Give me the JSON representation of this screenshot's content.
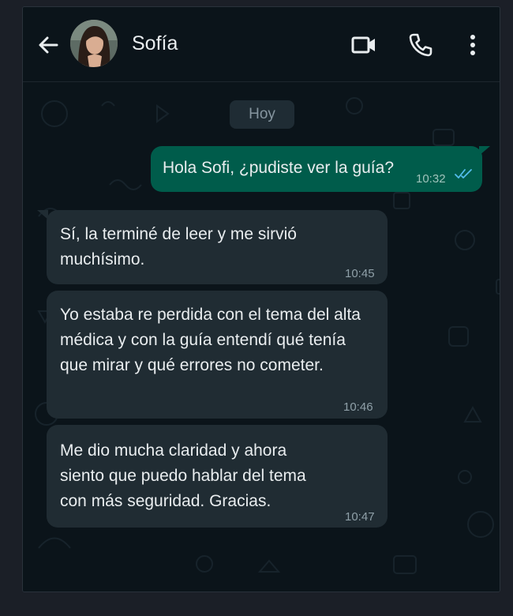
{
  "header": {
    "contact_name": "Sofía",
    "icons": [
      "arrow-back-icon",
      "avatar",
      "video-call-icon",
      "phone-call-icon",
      "more-vert-icon"
    ]
  },
  "chat": {
    "date_label": "Hoy",
    "messages": [
      {
        "direction": "outgoing",
        "text": "Hola Sofi, ¿pudiste ver la guía?",
        "time": "10:32",
        "status": "read"
      },
      {
        "direction": "incoming",
        "text": "Sí, la terminé de leer y me sirvió muchísimo.",
        "time": "10:45"
      },
      {
        "direction": "incoming",
        "text": "Yo estaba re perdida con el tema del alta médica y con la guía entendí qué tenía que mirar y qué errores no cometer.",
        "time": "10:46"
      },
      {
        "direction": "incoming",
        "text": "Me dio mucha claridad y ahora siento que puedo hablar del tema con más seguridad. Gracias.",
        "time": "10:47"
      }
    ]
  },
  "colors": {
    "background": "#0b141a",
    "incoming_bubble": "#202c33",
    "outgoing_bubble": "#005c4b",
    "read_ticks": "#53bdeb",
    "text": "#e9edef"
  }
}
